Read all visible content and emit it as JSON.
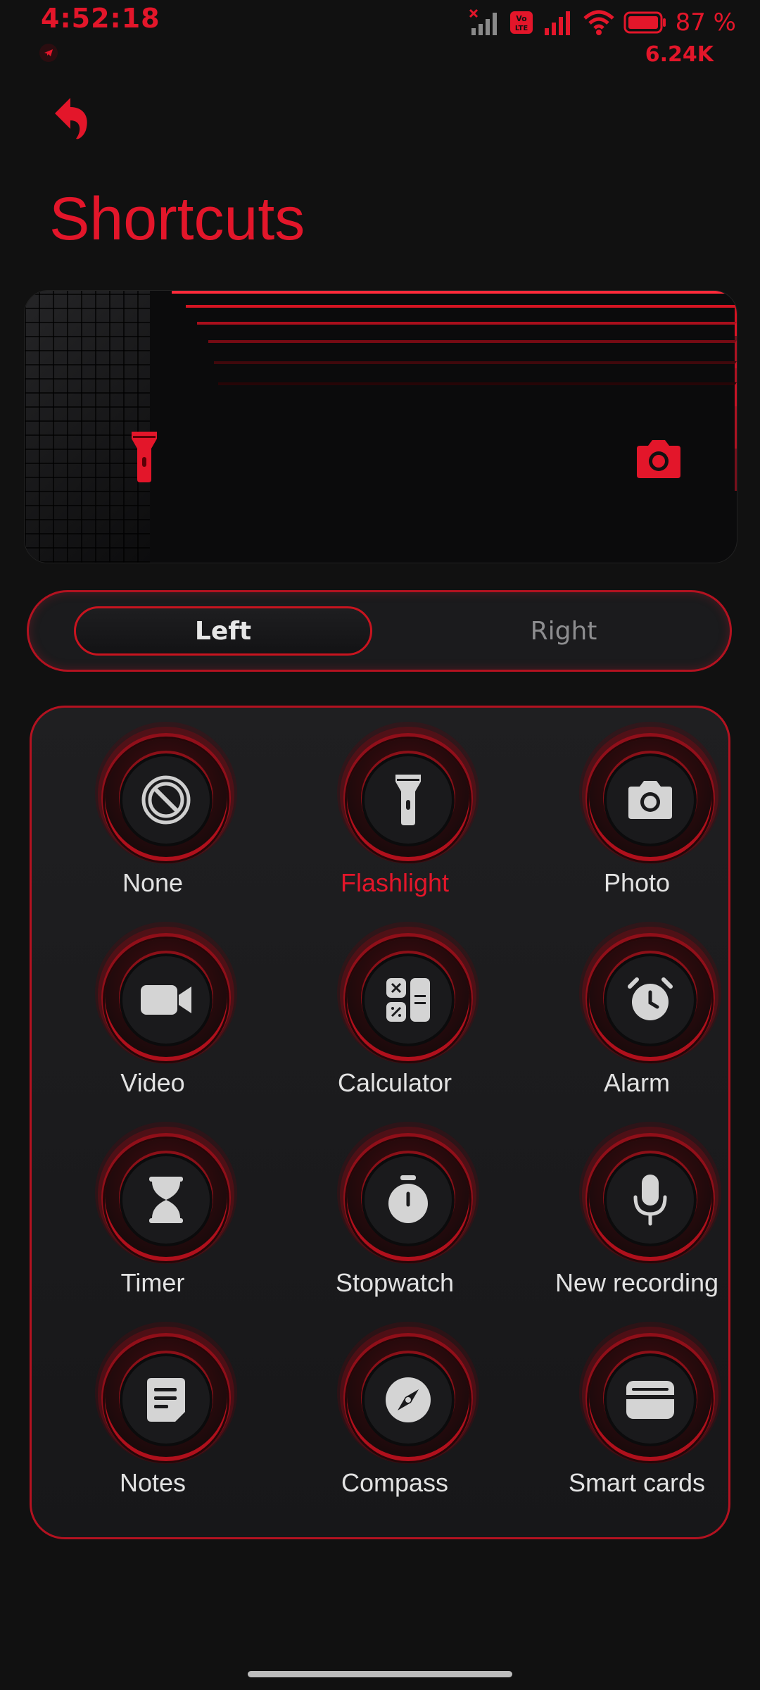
{
  "status_bar": {
    "time": "4:52:18",
    "battery_percent": "87 %",
    "net_speed": "6.24K",
    "icons": [
      "signal-no-service-icon",
      "volte-icon",
      "signal-icon",
      "wifi-icon",
      "battery-icon"
    ]
  },
  "header": {
    "title": "Shortcuts",
    "back_icon": "back-arrow-icon"
  },
  "preview": {
    "left_icon": "flashlight-icon",
    "right_icon": "camera-icon"
  },
  "segmented": {
    "left_label": "Left",
    "right_label": "Right",
    "selected": "Left"
  },
  "options": [
    {
      "label": "None",
      "icon": "none-icon"
    },
    {
      "label": "Flashlight",
      "icon": "flashlight-icon",
      "selected": true
    },
    {
      "label": "Photo",
      "icon": "camera-icon"
    },
    {
      "label": "Video",
      "icon": "video-icon"
    },
    {
      "label": "Calculator",
      "icon": "calculator-icon"
    },
    {
      "label": "Alarm",
      "icon": "alarm-icon"
    },
    {
      "label": "Timer",
      "icon": "hourglass-icon"
    },
    {
      "label": "Stopwatch",
      "icon": "stopwatch-icon"
    },
    {
      "label": "New recording",
      "icon": "microphone-icon"
    },
    {
      "label": "Notes",
      "icon": "notes-icon"
    },
    {
      "label": "Compass",
      "icon": "compass-icon"
    },
    {
      "label": "Smart cards",
      "icon": "wallet-card-icon"
    }
  ],
  "colors": {
    "accent": "#e3162a",
    "background": "#111111",
    "panel": "#1d1d1f",
    "icon_gray": "#d0d0d0"
  }
}
